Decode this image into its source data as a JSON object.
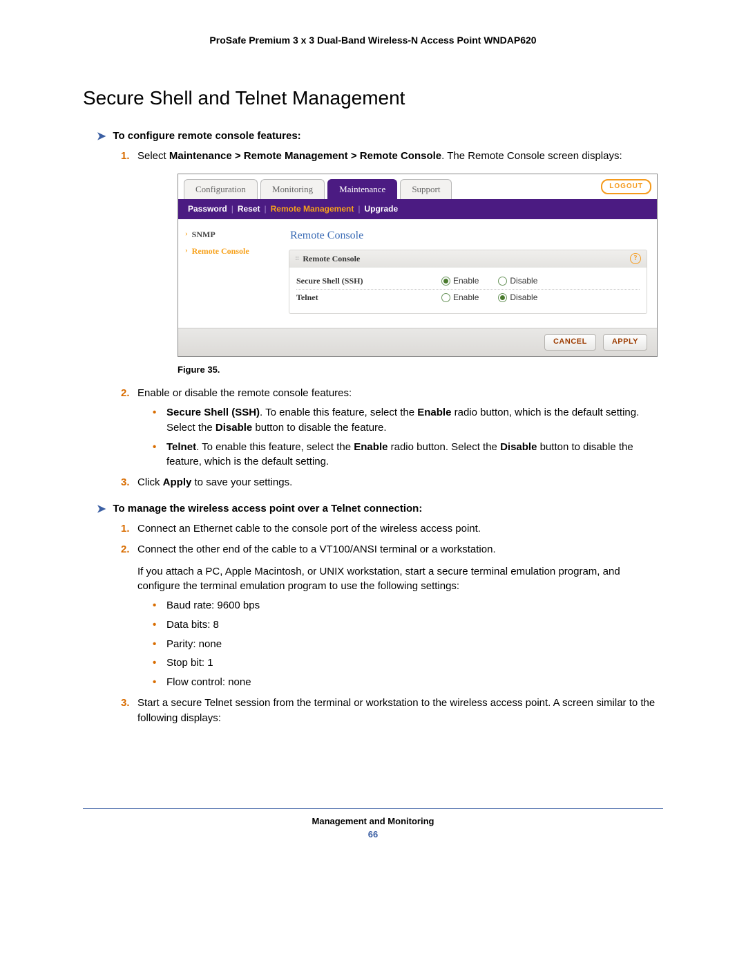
{
  "header": {
    "product": "ProSafe Premium 3 x 3 Dual-Band Wireless-N Access Point WNDAP620"
  },
  "title": "Secure Shell and Telnet Management",
  "proc1": {
    "heading": "To configure remote console features:",
    "step1_prefix": "Select ",
    "step1_bold": "Maintenance > Remote Management > Remote Console",
    "step1_suffix": ". The Remote Console screen displays:",
    "figure": "Figure 35.",
    "step2": "Enable or disable the remote console features:",
    "b1_bold": "Secure Shell (SSH)",
    "b1_t1": ". To enable this feature, select the ",
    "b1_b2": "Enable",
    "b1_t2": " radio button, which is the default setting. Select the ",
    "b1_b3": "Disable",
    "b1_t3": " button to disable the feature.",
    "b2_bold": "Telnet",
    "b2_t1": ". To enable this feature, select the ",
    "b2_b2": "Enable",
    "b2_t2": " radio button. Select the ",
    "b2_b3": "Disable",
    "b2_t3": " button to disable the feature, which is the default setting.",
    "step3_t1": "Click ",
    "step3_b1": "Apply",
    "step3_t2": " to save your settings."
  },
  "proc2": {
    "heading": "To manage the wireless access point over a Telnet connection:",
    "step1": "Connect an Ethernet cable to the console port of the wireless access point.",
    "step2": "Connect the other end of the cable to a VT100/ANSI terminal or a workstation.",
    "step2_cont": "If you attach a PC, Apple Macintosh, or UNIX workstation, start a secure terminal emulation program, and configure the terminal emulation program to use the following settings:",
    "settings": [
      "Baud rate: 9600 bps",
      "Data bits: 8",
      "Parity: none",
      "Stop bit: 1",
      "Flow control: none"
    ],
    "step3": "Start a secure Telnet session from the terminal or workstation to the wireless access point. A screen similar to the following displays:"
  },
  "ui": {
    "tabs": [
      "Configuration",
      "Monitoring",
      "Maintenance",
      "Support"
    ],
    "active_tab": "Maintenance",
    "logout": "LOGOUT",
    "subtabs": [
      "Password",
      "Reset",
      "Remote Management",
      "Upgrade"
    ],
    "active_subtab": "Remote Management",
    "side": [
      {
        "label": "SNMP",
        "active": false
      },
      {
        "label": "Remote Console",
        "active": true
      }
    ],
    "panel_title": "Remote Console",
    "panel_bar": "Remote Console",
    "rows": [
      {
        "label": "Secure Shell (SSH)",
        "enable": true
      },
      {
        "label": "Telnet",
        "enable": false
      }
    ],
    "opt_enable": "Enable",
    "opt_disable": "Disable",
    "cancel": "CANCEL",
    "apply": "APPLY"
  },
  "footer": {
    "section": "Management and Monitoring",
    "page": "66"
  }
}
